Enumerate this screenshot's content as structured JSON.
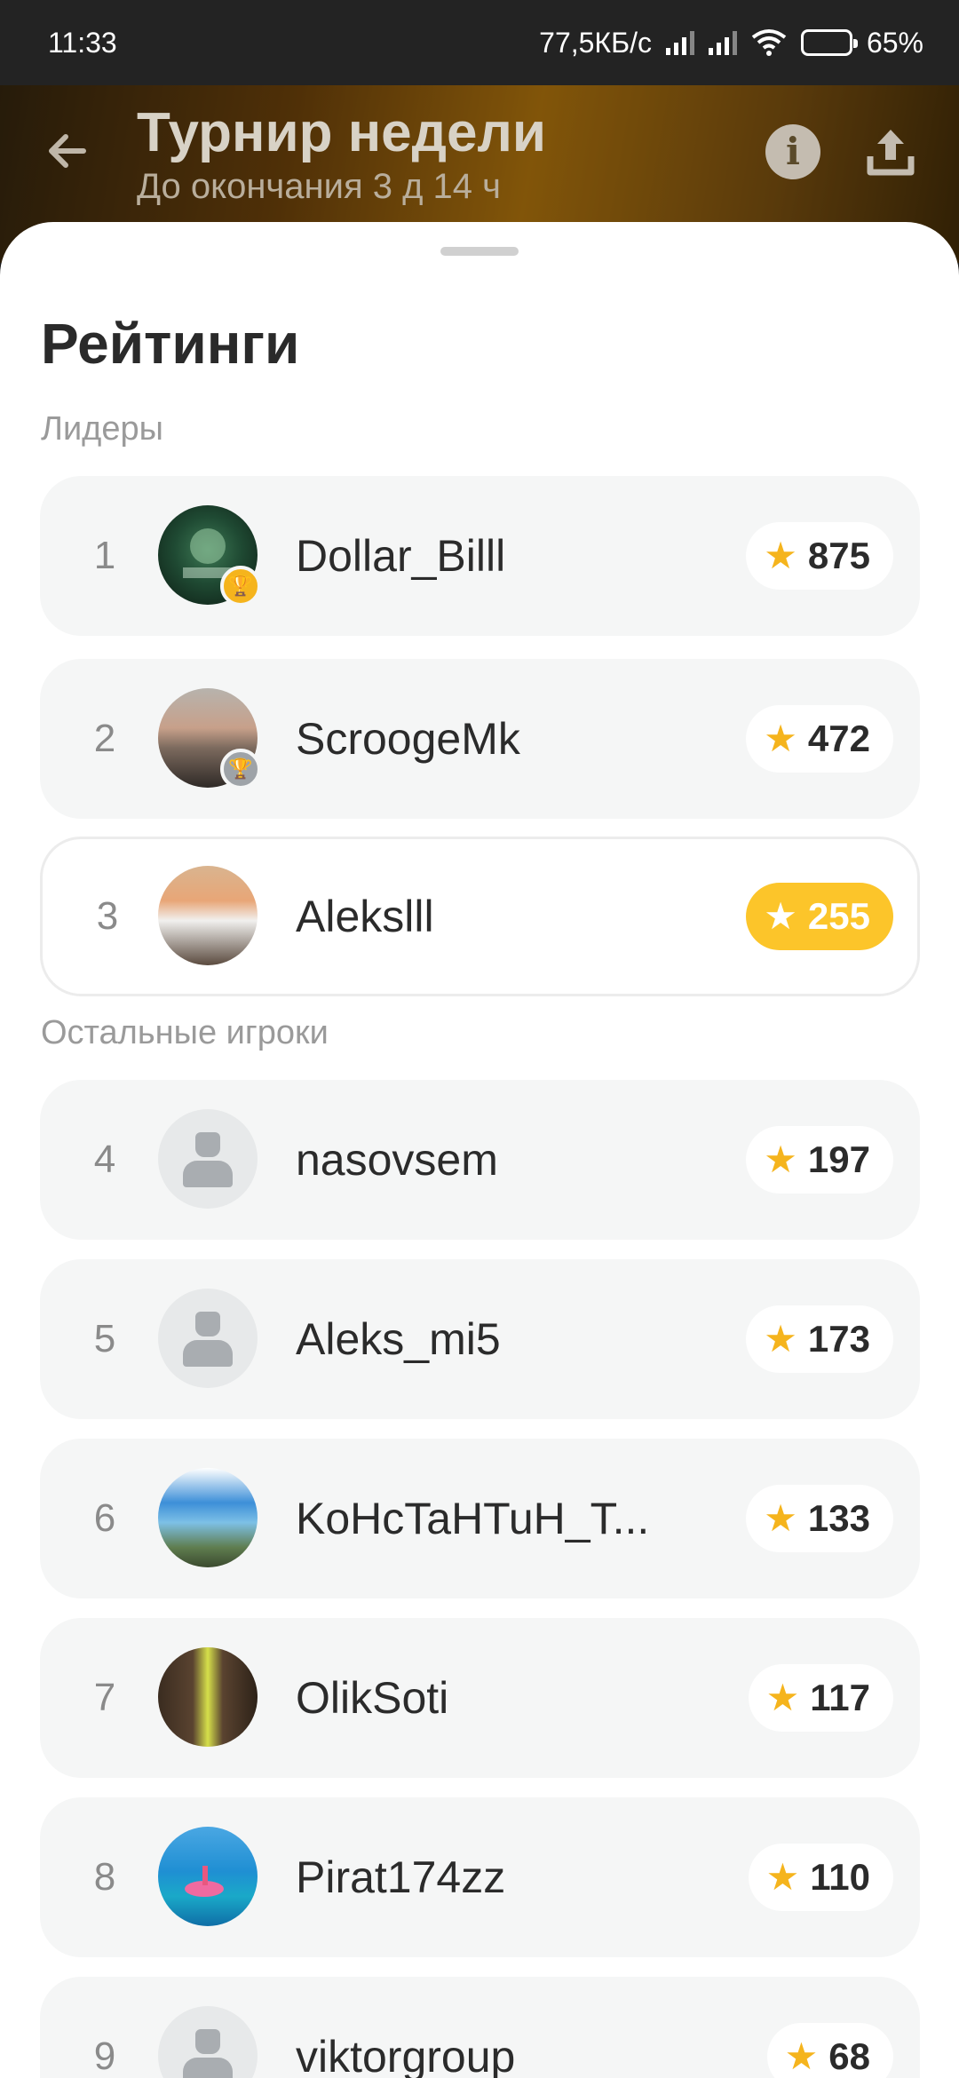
{
  "status_bar": {
    "time": "11:33",
    "network_speed": "77,5КБ/с",
    "battery": "65%",
    "battery_level": 0.65
  },
  "header": {
    "title": "Турнир недели",
    "subtitle": "До окончания 3 д 14 ч"
  },
  "sheet": {
    "title": "Рейтинги",
    "leaders_label": "Лидеры",
    "others_label": "Остальные игроки"
  },
  "players": [
    {
      "rank": "1",
      "name": "Dollar_Billl",
      "score": "875",
      "avatar": "photo",
      "badge": "gold-trophy"
    },
    {
      "rank": "2",
      "name": "ScroogeMk",
      "score": "472",
      "avatar": "photo",
      "badge": "silver-trophy"
    },
    {
      "rank": "3",
      "name": "Alekslll",
      "score": "255",
      "avatar": "photo",
      "current_user": true
    },
    {
      "rank": "4",
      "name": "nasovsem",
      "score": "197",
      "avatar": "placeholder"
    },
    {
      "rank": "5",
      "name": "Aleks_mi5",
      "score": "173",
      "avatar": "placeholder"
    },
    {
      "rank": "6",
      "name": "KoHcTaHTuH_T...",
      "score": "133",
      "avatar": "photo"
    },
    {
      "rank": "7",
      "name": "OlikSoti",
      "score": "117",
      "avatar": "photo"
    },
    {
      "rank": "8",
      "name": "Pirat174zz",
      "score": "110",
      "avatar": "photo"
    },
    {
      "rank": "9",
      "name": "viktorgroup",
      "score": "68",
      "avatar": "placeholder"
    }
  ],
  "colors": {
    "accent": "#fcc52a",
    "star": "#f5b41d",
    "row_bg": "#f5f6f6"
  }
}
